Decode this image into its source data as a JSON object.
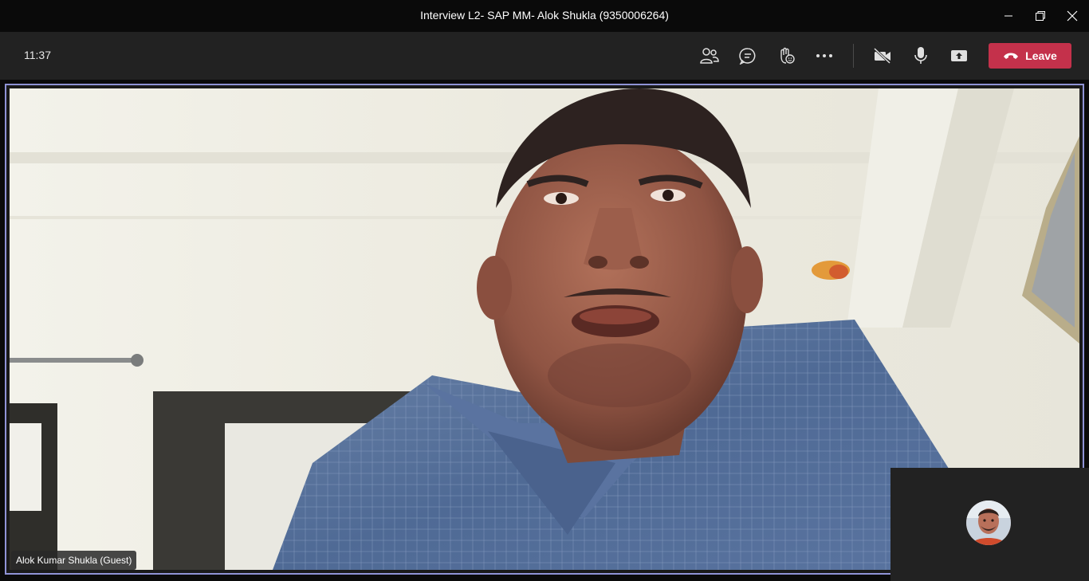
{
  "window": {
    "title": "Interview L2- SAP MM- Alok Shukla (9350006264)",
    "controls": [
      "minimize-icon",
      "restore-icon",
      "close-icon"
    ]
  },
  "toolbar": {
    "time": "11:37",
    "buttons": [
      "participants-icon",
      "chat-icon",
      "reactions-icon",
      "more-options-icon",
      "camera-off-icon",
      "microphone-icon",
      "share-screen-icon"
    ],
    "leave_label": "Leave"
  },
  "stage": {
    "participant_name": "Alok Kumar Shukla (Guest)"
  },
  "colors": {
    "toolbar_bg": "#222222",
    "stage_border": "#8f93d6",
    "leave_button": "#c4314b"
  }
}
